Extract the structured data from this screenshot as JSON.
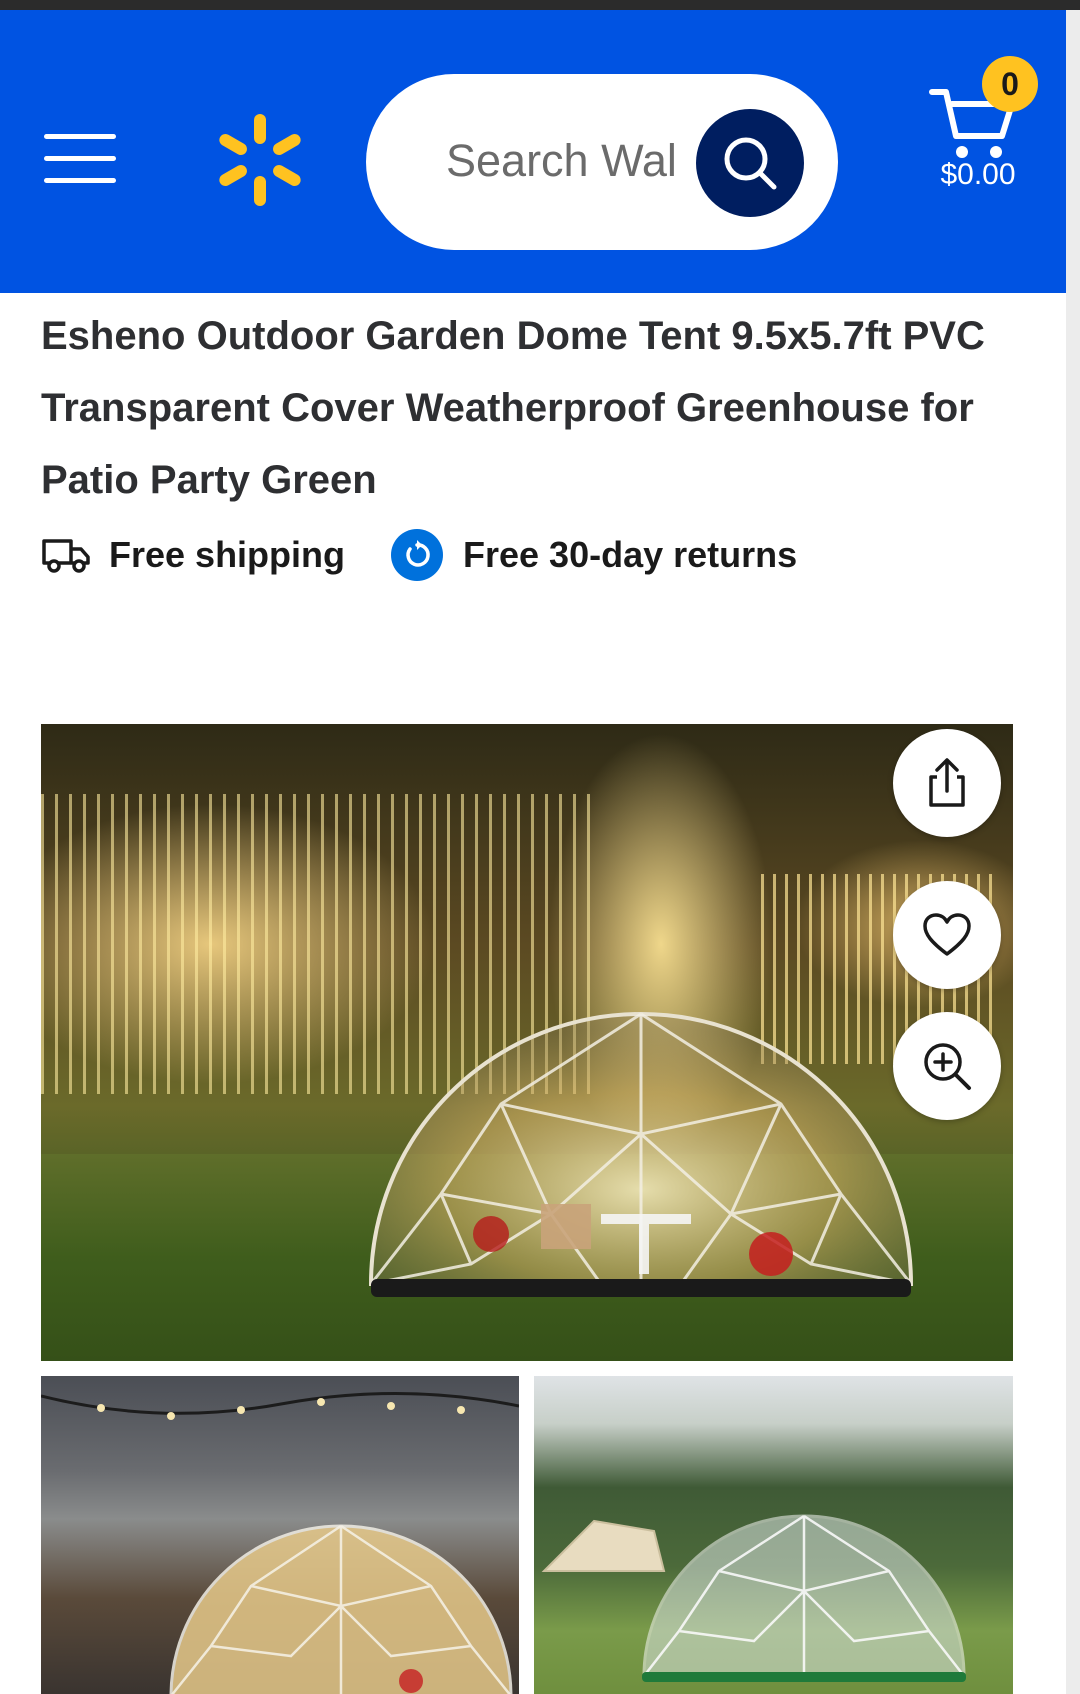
{
  "header": {
    "search_placeholder": "Search Wal",
    "cart_count": "0",
    "cart_total": "$0.00",
    "brand_color": "#0053e2",
    "accent_color": "#ffc220",
    "search_button_color": "#001e60"
  },
  "product": {
    "title": "Esheno Outdoor Garden Dome Tent 9.5x5.7ft PVC Transparent Cover Weatherproof Greenhouse for Patio Party Green",
    "perks": {
      "shipping": "Free shipping",
      "returns": "Free 30-day returns"
    }
  },
  "icons": {
    "menu": "hamburger-menu-icon",
    "logo": "walmart-spark-icon",
    "search": "search-icon",
    "cart": "cart-icon",
    "shipping": "truck-icon",
    "returns": "returns-icon",
    "share": "share-icon",
    "favorite": "heart-icon",
    "zoom": "zoom-in-icon"
  }
}
